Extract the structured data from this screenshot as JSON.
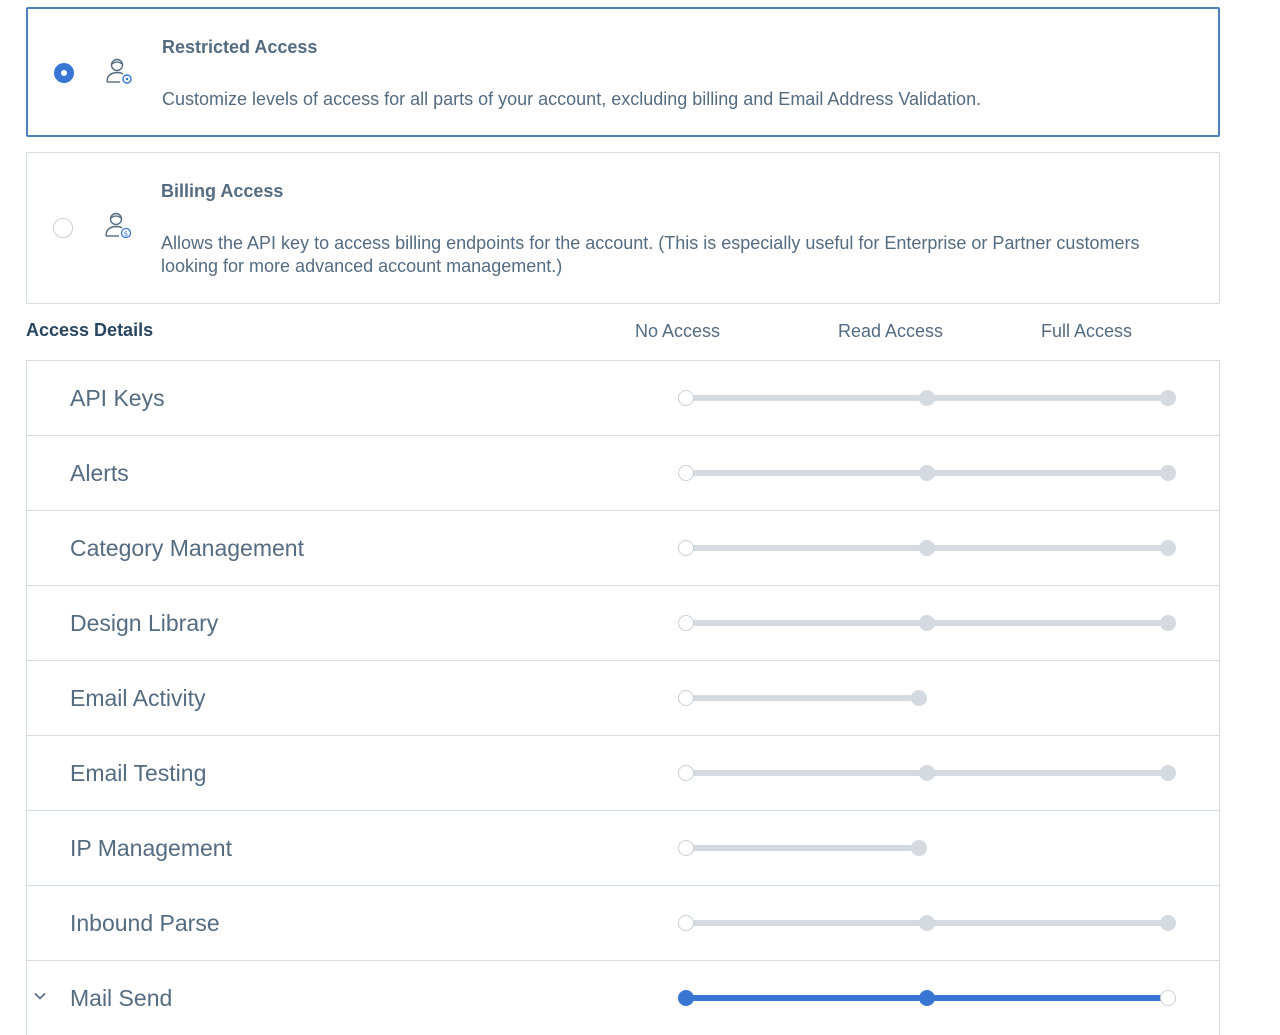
{
  "options": {
    "restricted": {
      "title": "Restricted Access",
      "description": "Customize levels of access for all parts of your account, excluding billing and Email Address Validation.",
      "selected": true,
      "icon": "user-gear-icon"
    },
    "billing": {
      "title": "Billing Access",
      "description": "Allows the API key to access billing endpoints for the account. (This is especially useful for Enterprise or Partner customers looking for more advanced account management.)",
      "selected": false,
      "icon": "user-dollar-icon"
    }
  },
  "access_details": {
    "title": "Access Details",
    "columns": [
      "No Access",
      "Read Access",
      "Full Access"
    ],
    "rows": [
      {
        "label": "API Keys",
        "levels": 3,
        "value": "No Access"
      },
      {
        "label": "Alerts",
        "levels": 3,
        "value": "No Access"
      },
      {
        "label": "Category Management",
        "levels": 3,
        "value": "No Access"
      },
      {
        "label": "Design Library",
        "levels": 3,
        "value": "No Access"
      },
      {
        "label": "Email Activity",
        "levels": 2,
        "value": "No Access"
      },
      {
        "label": "Email Testing",
        "levels": 3,
        "value": "No Access"
      },
      {
        "label": "IP Management",
        "levels": 2,
        "value": "No Access"
      },
      {
        "label": "Inbound Parse",
        "levels": 3,
        "value": "No Access"
      },
      {
        "label": "Mail Send",
        "levels": 3,
        "value": "Full Access",
        "expandable": true
      }
    ]
  },
  "colors": {
    "accent": "#3976d3",
    "track": "#d4dadf",
    "text": "#546b81",
    "heading": "#294661"
  }
}
